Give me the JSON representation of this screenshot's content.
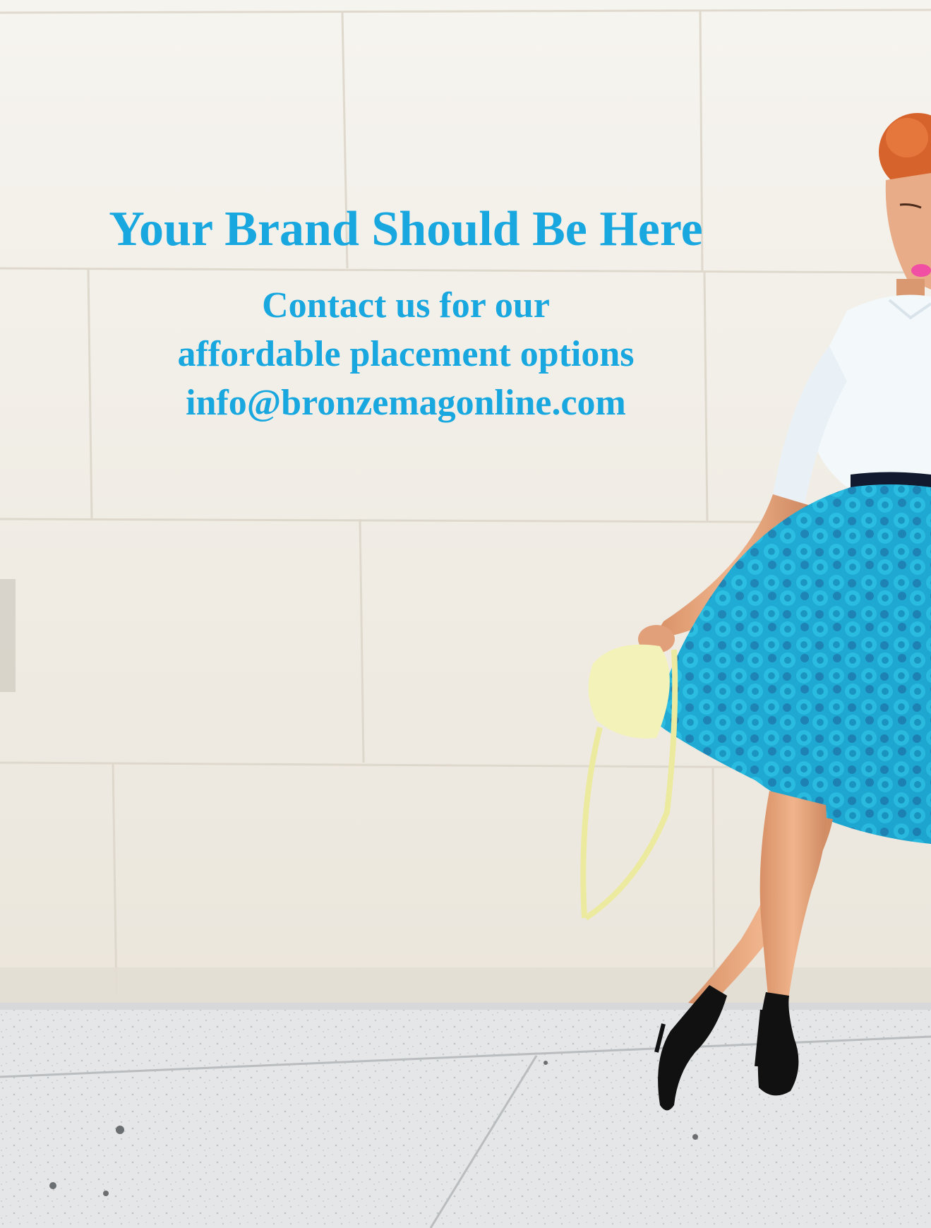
{
  "ad": {
    "headline": "Your Brand Should Be Here",
    "line1": "Contact us for our",
    "line2": "affordable placement options",
    "email": "info@bronzemagonline.com"
  },
  "colors": {
    "text": "#18a7df",
    "wall": "#efebe4",
    "sidewalk": "#e2e4e4",
    "skirt": "#20b3d6",
    "shirt": "#f4f8fb",
    "bag": "#f3f2b5",
    "shoe": "#111111",
    "skin": "#e5a57c",
    "hair": "#d7632c"
  }
}
